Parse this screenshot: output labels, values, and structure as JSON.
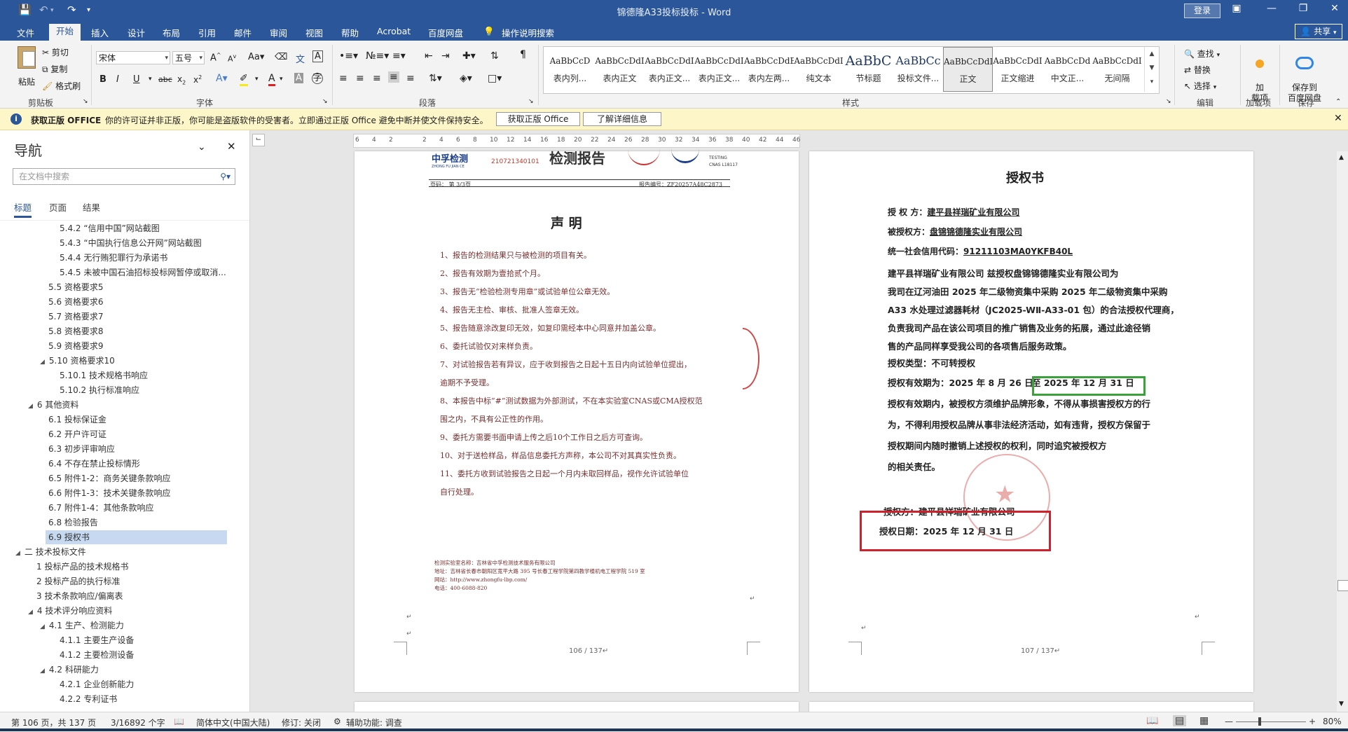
{
  "window": {
    "title": "锦德隆A33投标投标 - Word",
    "login": "登录",
    "share": "共享"
  },
  "menu_tabs": [
    "文件",
    "开始",
    "插入",
    "设计",
    "布局",
    "引用",
    "邮件",
    "审阅",
    "视图",
    "帮助",
    "Acrobat",
    "百度网盘"
  ],
  "tell_me": "操作说明搜索",
  "ribbon": {
    "clipboard": {
      "paste": "粘贴",
      "cut": "剪切",
      "copy": "复制",
      "format_painter": "格式刷",
      "label": "剪贴板"
    },
    "font": {
      "name": "宋体",
      "size": "五号",
      "label": "字体"
    },
    "paragraph": {
      "label": "段落"
    },
    "styles": {
      "label": "样式",
      "items": [
        {
          "sample": "AaBbCcD",
          "name": "表内列..."
        },
        {
          "sample": "AaBbCcDdI",
          "name": "表内正文"
        },
        {
          "sample": "AaBbCcDdI",
          "name": "表内正文..."
        },
        {
          "sample": "AaBbCcDdI",
          "name": "表内正文..."
        },
        {
          "sample": "AaBbCcDdE",
          "name": "表内左两..."
        },
        {
          "sample": "AaBbCcDdI",
          "name": "纯文本"
        },
        {
          "sample": "AaBbC",
          "name": "节标题"
        },
        {
          "sample": "AaBbCc",
          "name": "投标文件..."
        },
        {
          "sample": "AaBbCcDdI",
          "name": "正文"
        },
        {
          "sample": "AaBbCcDdI",
          "name": "正文缩进"
        },
        {
          "sample": "AaBbCcDd",
          "name": "中文正..."
        },
        {
          "sample": "AaBbCcDdI",
          "name": "无间隔"
        }
      ]
    },
    "editing": {
      "find": "查找",
      "replace": "替换",
      "select": "选择",
      "label": "编辑"
    },
    "addins": {
      "btn": "加\n载项",
      "label": "加载项"
    },
    "save": {
      "btn": "保存到\n百度网盘",
      "label": "保存"
    }
  },
  "warning": {
    "title": "获取正版 OFFICE",
    "text": "你的许可证并非正版，你可能是盗版软件的受害者。立即通过正版 Office 避免中断并使文件保持安全。",
    "btn1": "获取正版 Office",
    "btn2": "了解详细信息"
  },
  "nav": {
    "title": "导航",
    "search_placeholder": "在文档中搜索",
    "tabs": [
      "标题",
      "页面",
      "结果"
    ],
    "items": [
      {
        "text": "5.4.2 “信用中国”网站截图",
        "level": 3
      },
      {
        "text": "5.4.3 “中国执行信息公开网”网站截图",
        "level": 3
      },
      {
        "text": "5.4.4 无行贿犯罪行为承诺书",
        "level": 3
      },
      {
        "text": "5.4.5 未被中国石油招标投标网暂停或取消...",
        "level": 3
      },
      {
        "text": "5.5 资格要求5",
        "level": 2
      },
      {
        "text": "5.6 资格要求6",
        "level": 2
      },
      {
        "text": "5.7 资格要求7",
        "level": 2
      },
      {
        "text": "5.8 资格要求8",
        "level": 2
      },
      {
        "text": "5.9 资格要求9",
        "level": 2
      },
      {
        "text": "5.10 资格要求10",
        "level": 2,
        "tri": true
      },
      {
        "text": "5.10.1 技术规格书响应",
        "level": 3
      },
      {
        "text": "5.10.2 执行标准响应",
        "level": 3
      },
      {
        "text": "6 其他资料",
        "level": 1,
        "tri": true
      },
      {
        "text": "6.1 投标保证金",
        "level": 2
      },
      {
        "text": "6.2 开户许可证",
        "level": 2
      },
      {
        "text": "6.3 初步评审响应",
        "level": 2
      },
      {
        "text": "6.4 不存在禁止投标情形",
        "level": 2
      },
      {
        "text": "6.5 附件1-2：商务关键条款响应",
        "level": 2
      },
      {
        "text": "6.6 附件1-3：技术关键条款响应",
        "level": 2
      },
      {
        "text": "6.7 附件1-4：其他条款响应",
        "level": 2
      },
      {
        "text": "6.8 检验报告",
        "level": 2
      },
      {
        "text": "6.9 授权书",
        "level": 2,
        "selected": true
      },
      {
        "text": "二 技术投标文件",
        "level": 0,
        "tri": true
      },
      {
        "text": "1 投标产品的技术规格书",
        "level": 1
      },
      {
        "text": "2 投标产品的执行标准",
        "level": 1
      },
      {
        "text": "3 技术条款响应/偏离表",
        "level": 1
      },
      {
        "text": "4 技术评分响应资料",
        "level": 1,
        "tri": true
      },
      {
        "text": "4.1 生产、检测能力",
        "level": 2,
        "tri": true
      },
      {
        "text": "4.1.1 主要生产设备",
        "level": 3
      },
      {
        "text": "4.1.2 主要检测设备",
        "level": 3
      },
      {
        "text": "4.2 科研能力",
        "level": 2,
        "tri": true
      },
      {
        "text": "4.2.1 企业创新能力",
        "level": 3
      },
      {
        "text": "4.2.2 专利证书",
        "level": 3
      }
    ]
  },
  "ruler_ticks": [
    "6",
    "4",
    "2",
    "",
    "2",
    "4",
    "6",
    "8",
    "10",
    "12",
    "14",
    "16",
    "18",
    "20",
    "22",
    "24",
    "26",
    "28",
    "30",
    "32",
    "34",
    "36",
    "38",
    "40",
    "42",
    "44",
    "46"
  ],
  "page_left": {
    "header_logo": "中孚检测",
    "header_logo_sub": "ZHONG FU JIAN CE",
    "header_code": "210721340101",
    "header_title": "检测报告",
    "testing": "TESTING",
    "cnas": "CNAS L18117",
    "page_label": "页码：  第 3/3页",
    "report_no": "报告编号：ZF20257A48C2873",
    "title": "声  明",
    "lines": [
      "1、报告的检测结果只与被检测的项目有关。",
      "2、报告有效期为壹拾贰个月。",
      "3、报告无“检验检测专用章”或试验单位公章无效。",
      "4、报告无主检、审核、批准人签章无效。",
      "5、报告随意涂改复印无效，如复印需经本中心同意并加盖公章。",
      "6、委托试验仅对来样负责。",
      "7、对试验报告若有异议，应于收到报告之日起十五日内向试验单位提出，",
      "逾期不予受理。",
      "8、本报告中标“#”测试数据为外部测试，不在本实验室CNAS或CMA授权范",
      "围之内，不具有公正性的作用。",
      "9、委托方需要书面申请上传之后10个工作日之后方可查询。",
      "10、对于送检样品，样品信息委托方声称，本公司不对其真实性负责。",
      "11、委托方收到试验报告之日起一个月内未取回样品，视作允许试验单位",
      "自行处理。"
    ],
    "footer": [
      "检测实验室名称：吉林省中孚检测技术服务有限公司",
      "地址：吉林省长春市朝阳区宽平大路 395 号长春工程学院第四教学楼机电工程学院 519 室",
      "网站：http://www.zhongfu-lbp.com/",
      "电话：400-6088-820"
    ],
    "page_num": "106 / 137↵"
  },
  "page_right": {
    "title": "授权书",
    "grantor_label": "授 权 方：",
    "grantor": "建平县祥瑞矿业有限公司",
    "grantee_label": "被授权方：",
    "grantee": "盘锦锦德隆实业有限公司",
    "credit_label": "统一社会信用代码：",
    "credit_code": "91211103MA0YKFB40L",
    "body": [
      "   建平县祥瑞矿业有限公司  兹授权盘锦锦德隆实业有限公司为",
      "我司在辽河油田 2025 年二级物资集中采购 2025 年二级物资集中采购",
      "A33 水处理过滤器耗材（JC2025-WⅡ-A33-01 包）的合法授权代理商，",
      "负责我司产品在该公司项目的推广销售及业务的拓展，通过此途径销",
      "售的产品同样享受我公司的各项售后服务政策。"
    ],
    "type_line": "授权类型：不可转授权",
    "validity_prefix": "授权有效期为：2025 年 8 月 26  日",
    "validity_end": "至 2025 年 12 月 31 日",
    "body2": [
      "授权有效期内，被授权方须维护品牌形象，不得从事损害授权方的行",
      "为，不得利用授权品牌从事非法经济活动，如有违背，授权方保留于",
      "授权期间内随时撤销上述授权的权利，同时追究被授权方",
      "的相关责任。"
    ],
    "sign_label": "授权方：建平县祥瑞矿业有限公司",
    "date_line": "授权日期：2025 年 12 月 31 日",
    "page_num": "107 / 137↵",
    "highlight_green": "#3aa23a",
    "highlight_red": "#d0202b"
  },
  "status": {
    "page": "第 106 页，共 137 页",
    "words": "3/16892 个字",
    "lang": "简体中文(中国大陆)",
    "track": "修订: 关闭",
    "access": "辅助功能: 调查",
    "zoom": "80%"
  }
}
